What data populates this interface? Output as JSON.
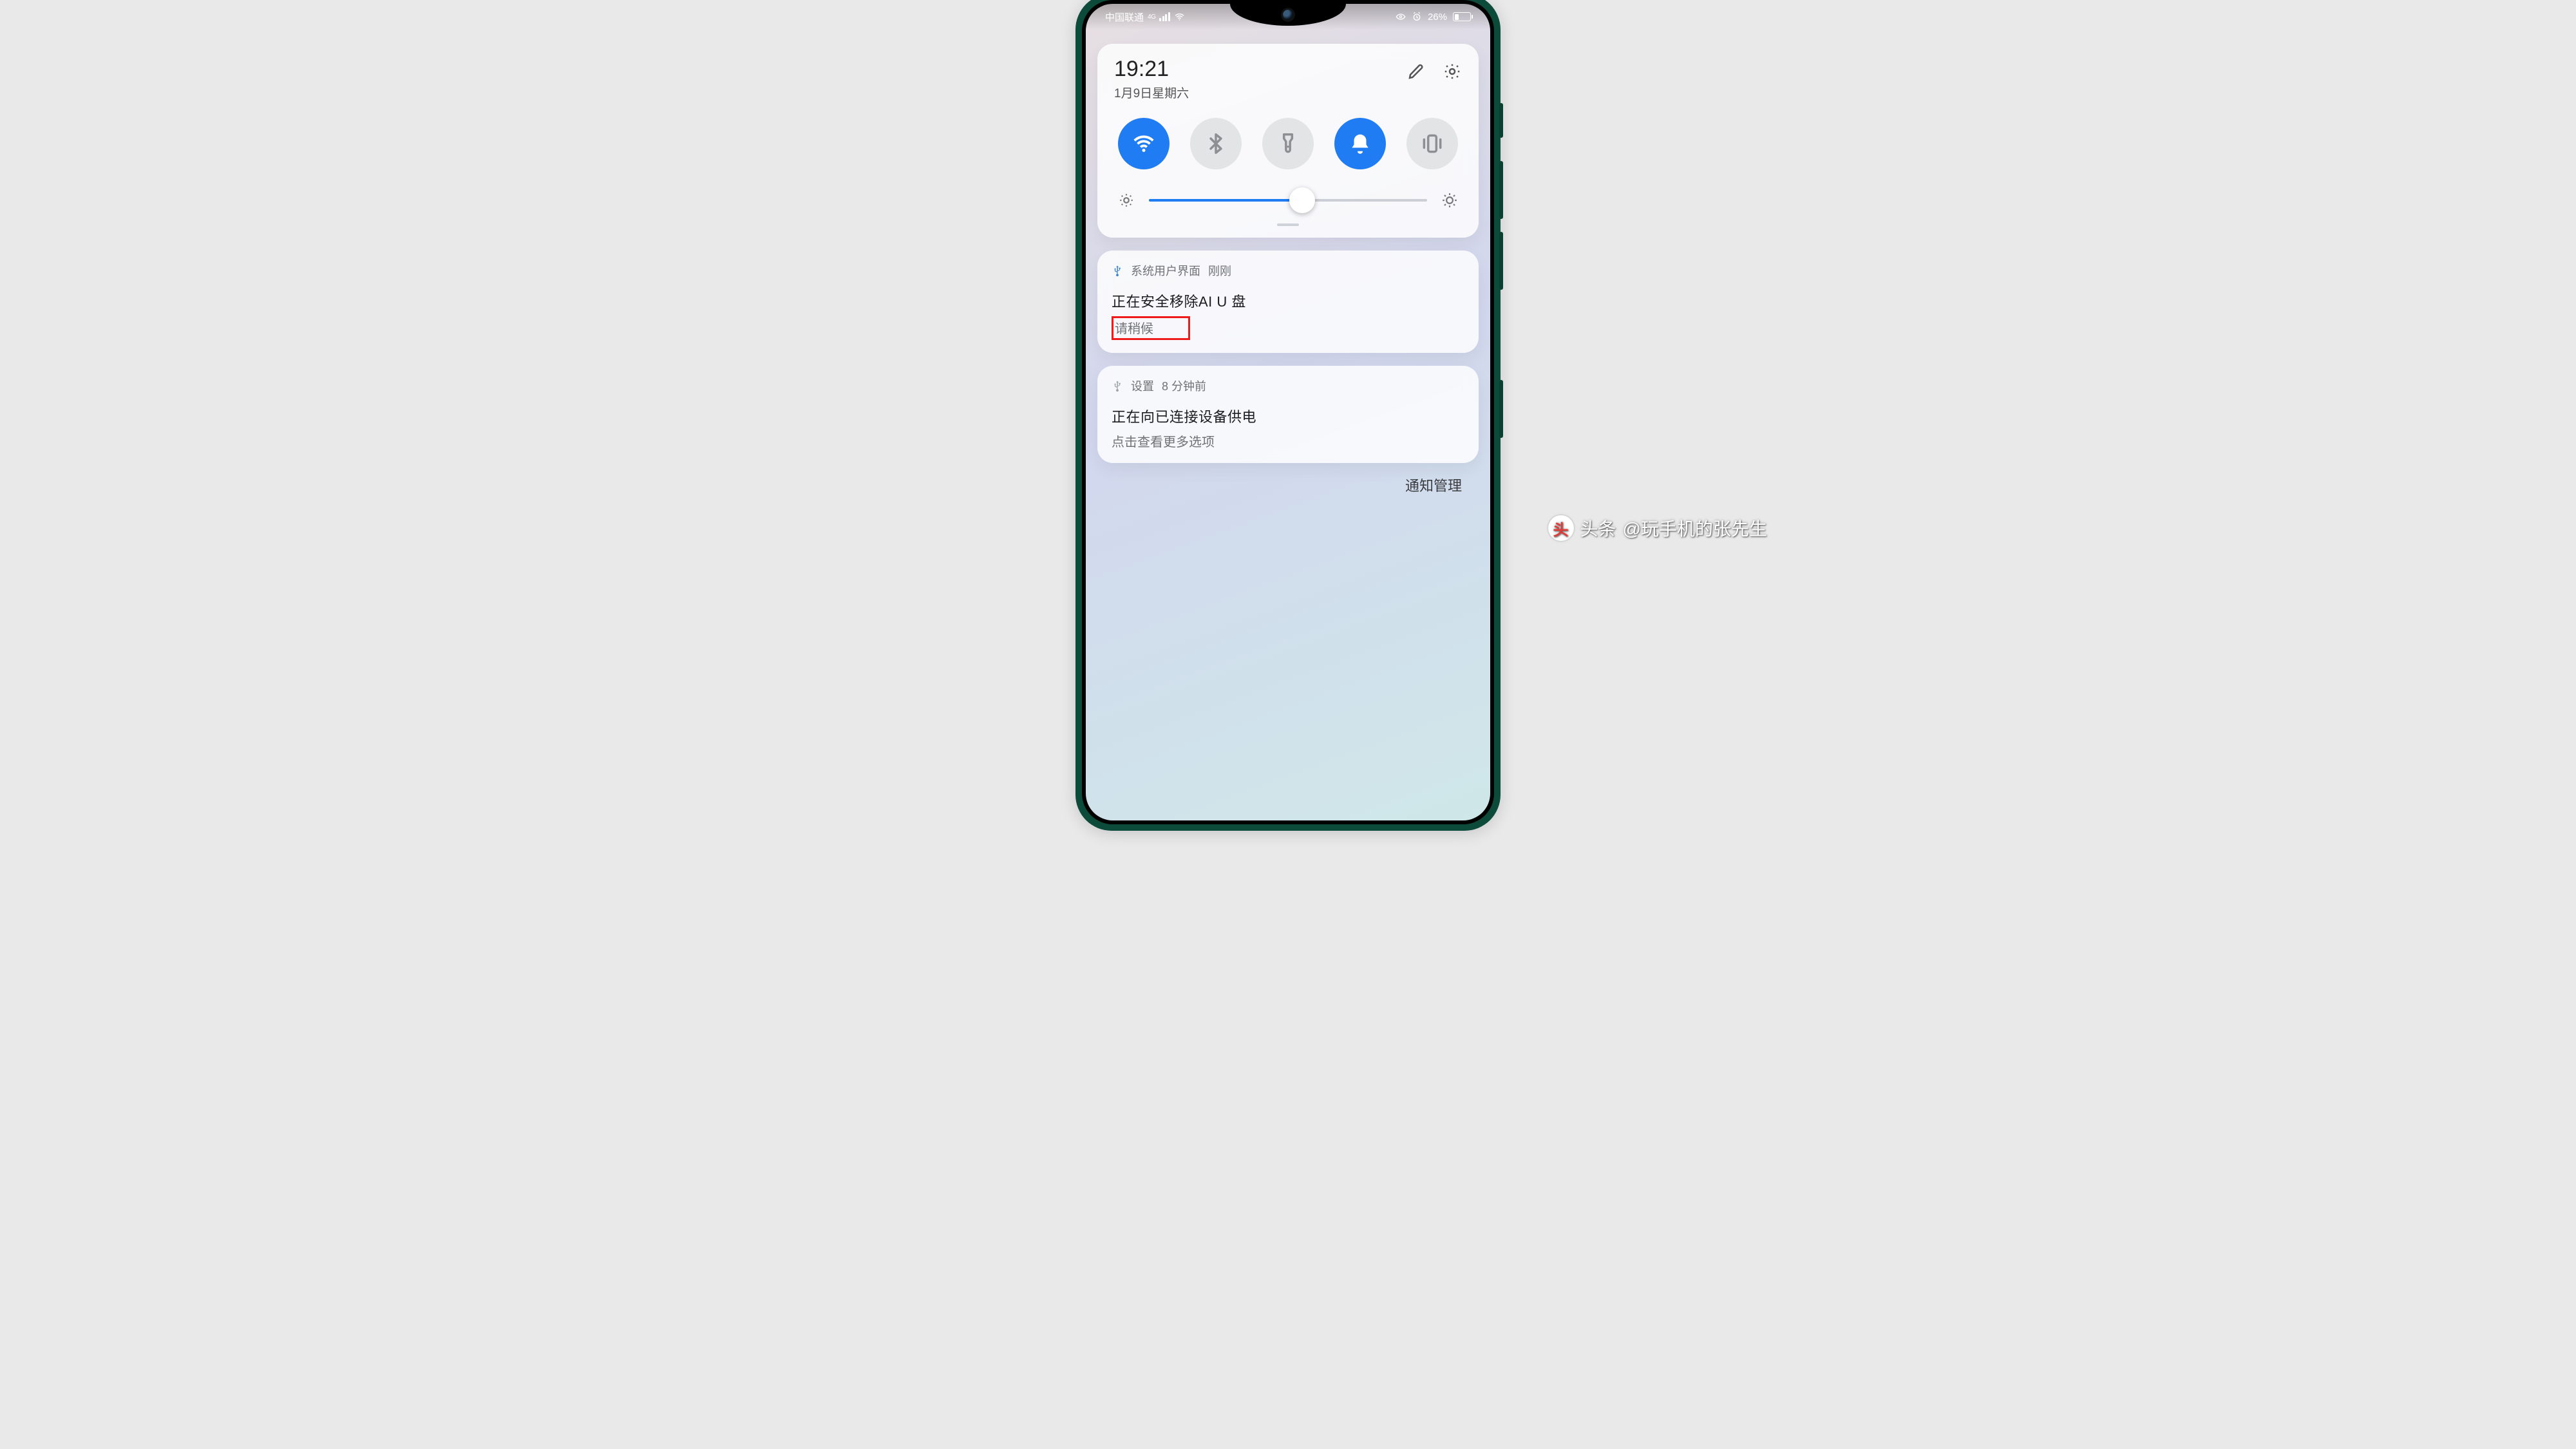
{
  "status": {
    "carrier": "中国联通",
    "net_badge": "4G",
    "battery_text": "26%",
    "battery_pct": 26
  },
  "qs": {
    "time": "19:21",
    "date": "1月9日星期六",
    "brightness_pct": 55,
    "toggles": {
      "wifi_on": true,
      "bluetooth_on": false,
      "flashlight_on": false,
      "bell_on": true,
      "vibrate_on": false
    }
  },
  "notifications": [
    {
      "app": "系统用户界面",
      "time": "刚刚",
      "title": "正在安全移除AI U 盘",
      "subtitle": "请稍候",
      "highlight_sub": true,
      "icon": "usb-blue"
    },
    {
      "app": "设置",
      "time": "8 分钟前",
      "title": "正在向已连接设备供电",
      "subtitle": "点击查看更多选项",
      "highlight_sub": false,
      "icon": "usb-gray"
    }
  ],
  "footer": {
    "manage": "通知管理"
  },
  "watermark": {
    "prefix": "头条",
    "handle": "@玩手机的张先生"
  }
}
